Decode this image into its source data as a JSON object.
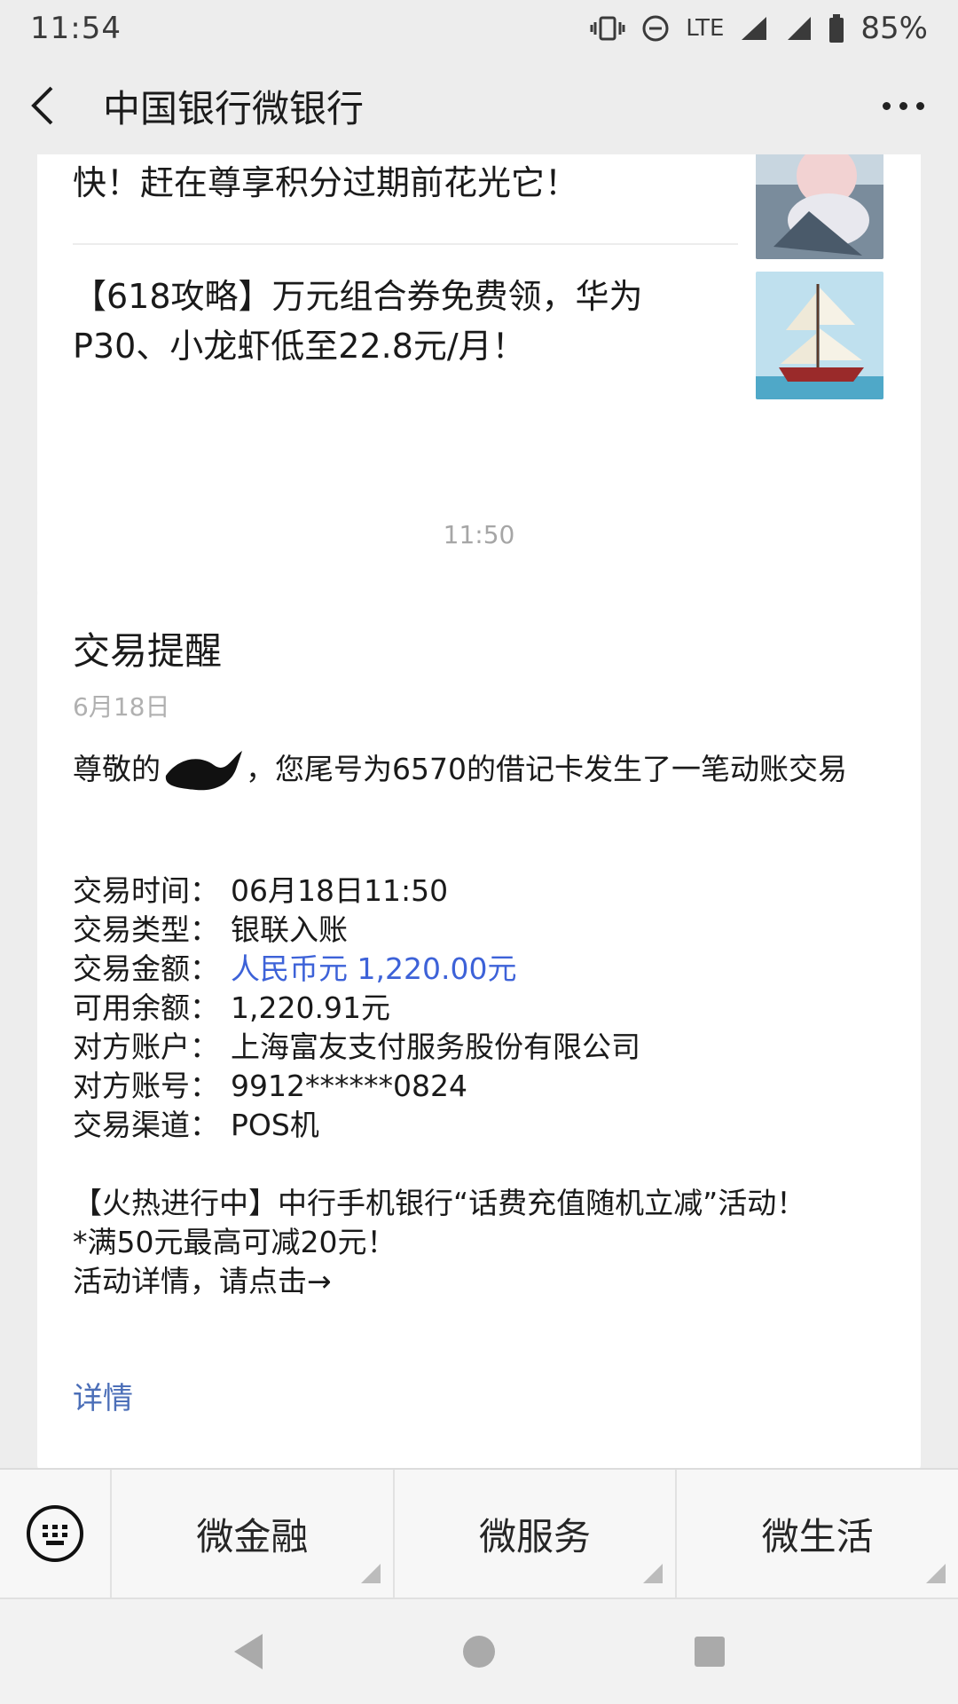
{
  "status_bar": {
    "time": "11:54",
    "network": "LTE",
    "battery": "85%"
  },
  "header": {
    "title": "中国银行微银行"
  },
  "news": [
    {
      "text": "快！赶在尊享积分过期前花光它！"
    },
    {
      "text": "【618攻略】万元组合券免费领，华为P30、小龙虾低至22.8元/月！"
    }
  ],
  "timestamp": "11:50",
  "message": {
    "title": "交易提醒",
    "date": "6月18日",
    "greeting_prefix": "尊敬的",
    "greeting_suffix": "，您尾号为6570的借记卡发生了一笔动账交易",
    "rows": [
      {
        "label": "交易时间：",
        "value": "06月18日11:50"
      },
      {
        "label": "交易类型：",
        "value": "银联入账"
      },
      {
        "label": "交易金额：",
        "value": "人民币元 1,220.00元"
      },
      {
        "label": "可用余额：",
        "value": "1,220.91元"
      },
      {
        "label": "对方账户：",
        "value": "上海富友支付服务股份有限公司"
      },
      {
        "label": "对方账号：",
        "value": "9912******0824"
      },
      {
        "label": "交易渠道：",
        "value": "POS机"
      }
    ],
    "promo_lines": [
      "【火热进行中】中行手机银行“话费充值随机立减”活动！",
      "*满50元最高可减20元！",
      "活动详情，请点击→"
    ],
    "detail_link": "详情"
  },
  "menu": {
    "tabs": [
      "微金融",
      "微服务",
      "微生活"
    ]
  },
  "colors": {
    "accent_blue": "#3d62d8",
    "link_blue": "#4c6fb8",
    "background": "#ededed"
  }
}
